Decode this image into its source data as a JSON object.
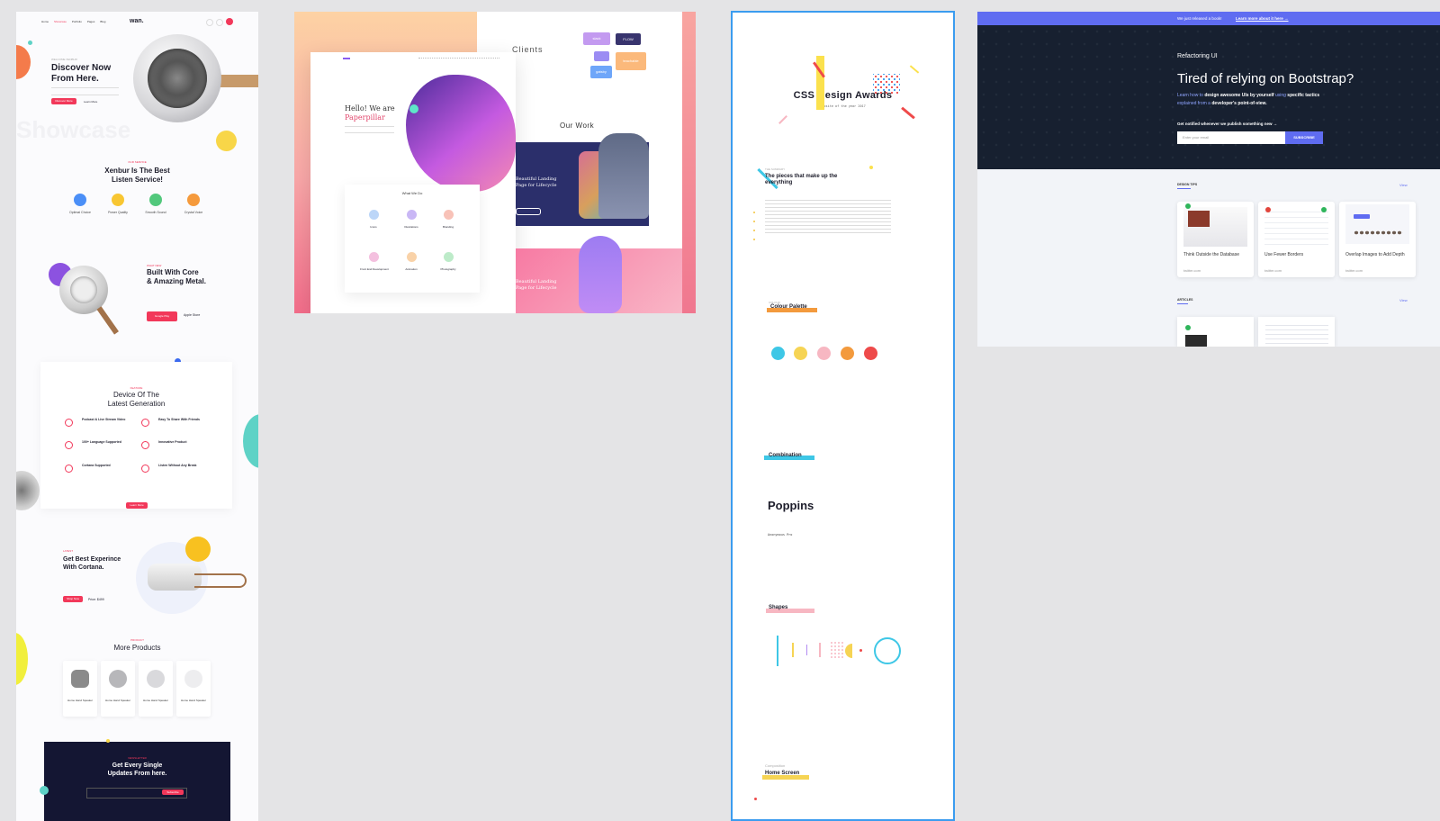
{
  "artboard1": {
    "nav": [
      "Home",
      "Showcase",
      "Portfolio",
      "Pages",
      "Blog"
    ],
    "logo": "wan.",
    "hero_eyebrow": "WELCOME XENBUR",
    "hero_title_1": "Discover Now",
    "hero_title_2": "From Here.",
    "hero_btn": "Discover More",
    "hero_btn2": "Learn More",
    "watermark": "Showcase",
    "service_eyebrow": "OUR SERVICE",
    "service_title_1": "Xenbur Is The Best",
    "service_title_2": "Listen Service!",
    "features": [
      "Optimal Choice",
      "Power Quality",
      "Smooth Sound",
      "Crystal Voice"
    ],
    "built_eyebrow": "WHAT NEW",
    "built_title_1": "Built With Core",
    "built_title_2": "& Amazing Metal.",
    "google_play": "Google Play",
    "apple_store": "Apple Store",
    "device_eyebrow": "FEATURE",
    "device_title_1": "Device Of The",
    "device_title_2": "Latest Generation",
    "device_features": [
      "Podcast & Live Stream Video",
      "Easy To Share With Friends",
      "100+ Language Supported",
      "Innovative Product",
      "Cortana Supported",
      "Listen Without Any Break"
    ],
    "device_btn": "Learn More",
    "exp_eyebrow": "LATEST",
    "exp_title_1": "Get Best Experince",
    "exp_title_2": "With Cortana.",
    "exp_btn": "Shop Now",
    "exp_price": "Price: $499",
    "products_eyebrow": "PRODUCT",
    "products_title": "More Products",
    "products": [
      "Home Hand Speaker",
      "Home Hand Speaker",
      "Home Hand Speaker",
      "Home Hand Speaker"
    ],
    "newsletter_eyebrow": "NEWSLETTER",
    "newsletter_title_1": "Get Every Single",
    "newsletter_title_2": "Updates From here.",
    "newsletter_btn": "Subscribe"
  },
  "artboard2": {
    "clients_title": "Clients",
    "our_work": "Our Work",
    "hero_1": "Hello! We are",
    "hero_2": "Paperpillar",
    "what_we_do": "What We Do",
    "services": [
      "Icons",
      "Illustrations",
      "Branding",
      "Front End Development",
      "Animation",
      "Photography"
    ],
    "landing_1": "Beautiful Landing",
    "landing_2": "Page for Lifecycle",
    "logos": [
      "slack",
      "FLOW",
      "teachable",
      "gatsby"
    ]
  },
  "artboard3": {
    "title": "CSS Design Awards",
    "subtitle": "Website of the year 2017",
    "intro_eyebrow": "THE SUMMARY",
    "intro_title_1": "The pieces that make up the",
    "intro_title_2": "everything",
    "colour_label": "Colour Palette",
    "colour_eyebrow": "COLOUR",
    "colors": [
      "#3ec7e6",
      "#f6d454",
      "#f7b7c2",
      "#f39a3d",
      "#ee4a4a"
    ],
    "combination_label": "Combination",
    "font_name": "Poppins",
    "font_alt": "Anonymous Pro",
    "shapes_label": "Shapes",
    "composition_eyebrow": "Composition",
    "home_label": "Home Screen"
  },
  "artboard4": {
    "banner": "We just released a book!",
    "banner_link": "Learn more about it here →",
    "logo": "Refactoring UI",
    "title": "Tired of relying on Bootstrap?",
    "sub_1": "Learn how to",
    "sub_2": "design awesome UIs by yourself",
    "sub_3": "using",
    "sub_4": "specific tactics",
    "sub_5": "explained from a",
    "sub_6": "developer's point-of-view.",
    "notify": "Get notified whenever we publish something new →",
    "email_placeholder": "Enter your email",
    "subscribe": "SUBSCRIBE",
    "design_tips": "DESIGN TIPS",
    "view_all": "View",
    "tips": [
      "Think Outside the Database",
      "Use Fewer Borders",
      "Overlap Images to Add Depth"
    ],
    "tip_link": "twitter.com",
    "articles": "ARTICLES"
  }
}
